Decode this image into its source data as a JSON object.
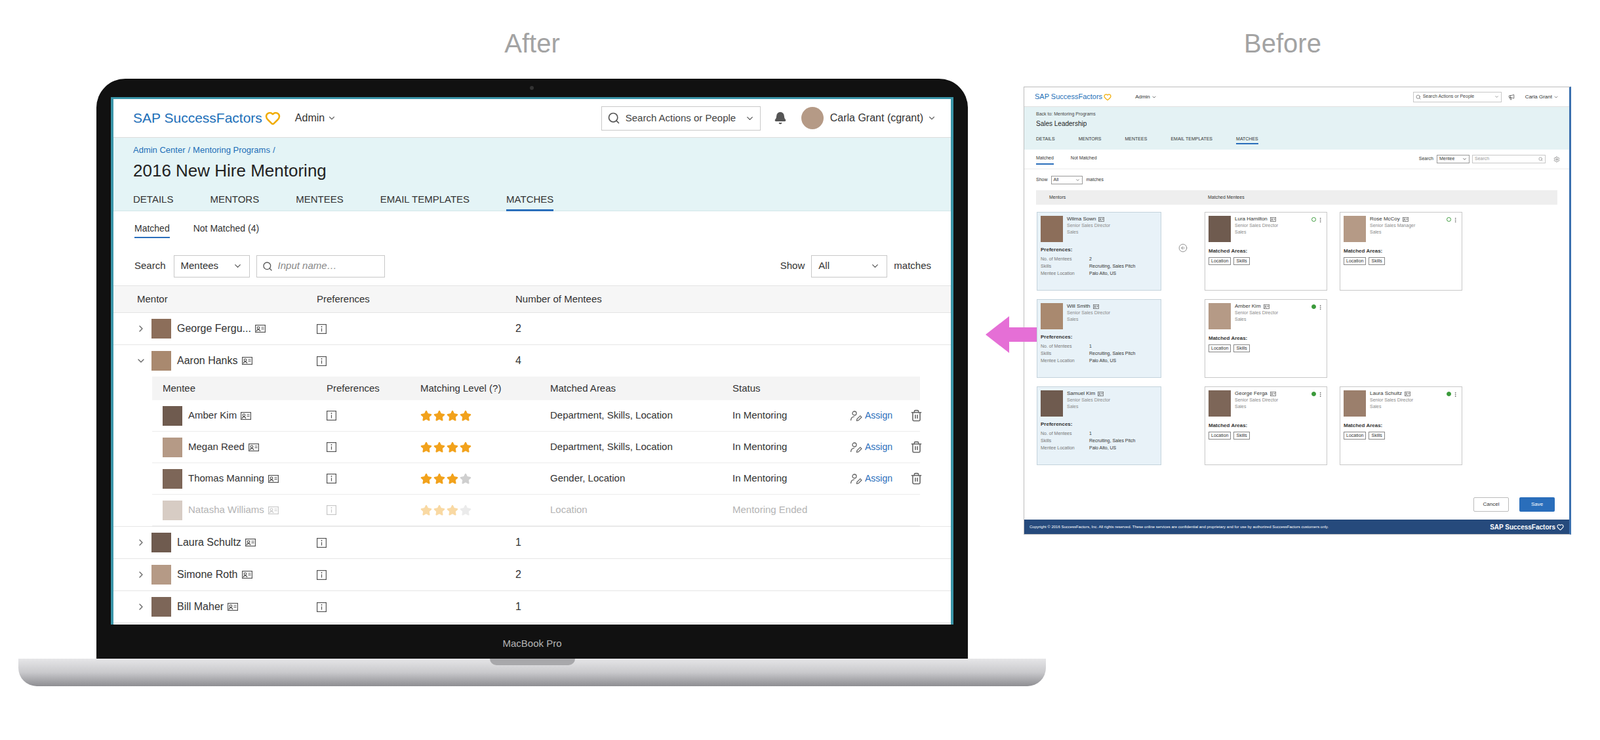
{
  "page_labels": {
    "after": "After",
    "before": "Before"
  },
  "laptop": {
    "model": "MacBook Pro"
  },
  "after": {
    "header": {
      "logo": "SAP SuccessFactors",
      "menu": "Admin",
      "search_placeholder": "Search Actions or People",
      "user": "Carla Grant (cgrant)"
    },
    "breadcrumb": {
      "items": [
        "Admin Center",
        "Mentoring Programs"
      ],
      "separator": "/"
    },
    "title": "2016 New Hire Mentoring",
    "tabs": [
      {
        "label": "DETAILS",
        "selected": false
      },
      {
        "label": "MENTORS",
        "selected": false
      },
      {
        "label": "MENTEES",
        "selected": false
      },
      {
        "label": "EMAIL TEMPLATES",
        "selected": false
      },
      {
        "label": "MATCHES",
        "selected": true
      }
    ],
    "subtabs": [
      {
        "label": "Matched",
        "selected": true
      },
      {
        "label": "Not Matched (4)",
        "selected": false
      }
    ],
    "search": {
      "label": "Search",
      "scope": "Mentees",
      "placeholder": "Input name…"
    },
    "show": {
      "label": "Show",
      "value": "All",
      "suffix": "matches"
    },
    "mentor_columns": [
      "Mentor",
      "Preferences",
      "Number of Mentees"
    ],
    "mentee_columns": [
      "Mentee",
      "Preferences",
      "Matching Level (?)",
      "Matched Areas",
      "Status"
    ],
    "mentors": [
      {
        "name": "George Fergu...",
        "mentees_count": "2",
        "expanded": false
      },
      {
        "name": "Aaron Hanks",
        "mentees_count": "4",
        "expanded": true,
        "mentees": [
          {
            "name": "Amber Kim",
            "stars": 4,
            "areas": "Department, Skills, Location",
            "status": "In Mentoring",
            "disabled": false,
            "action": "Assign"
          },
          {
            "name": "Megan Reed",
            "stars": 4,
            "areas": "Department, Skills, Location",
            "status": "In Mentoring",
            "disabled": false,
            "action": "Assign"
          },
          {
            "name": "Thomas Manning",
            "stars": 3,
            "areas": "Gender, Location",
            "status": "In Mentoring",
            "disabled": false,
            "action": "Assign"
          },
          {
            "name": "Natasha Williams",
            "stars": 3,
            "areas": "Location",
            "status": "Mentoring Ended",
            "disabled": true
          }
        ]
      },
      {
        "name": "Laura Schultz",
        "mentees_count": "1",
        "expanded": false
      },
      {
        "name": "Simone Roth",
        "mentees_count": "2",
        "expanded": false
      },
      {
        "name": "Bill Maher",
        "mentees_count": "1",
        "expanded": false
      }
    ]
  },
  "before": {
    "header": {
      "logo": "SAP SuccessFactors",
      "menu": "Admin",
      "search_placeholder": "Search Actions or People",
      "user": "Carla Grant"
    },
    "back_link": "Back to: Mentoring Programs",
    "title": "Sales Leadership",
    "tabs": [
      {
        "label": "DETAILS",
        "selected": false
      },
      {
        "label": "MENTORS",
        "selected": false
      },
      {
        "label": "MENTEES",
        "selected": false
      },
      {
        "label": "EMAIL TEMPLATES",
        "selected": false
      },
      {
        "label": "MATCHES",
        "selected": true
      }
    ],
    "subtabs": [
      {
        "label": "Matched",
        "selected": true
      },
      {
        "label": "Not Matched",
        "selected": false
      }
    ],
    "search": {
      "label": "Search",
      "scope": "Mentee",
      "placeholder": "Search"
    },
    "show": {
      "label": "Show",
      "value": "All",
      "suffix": "matches"
    },
    "columns": [
      "Mentors",
      "Matched Mentees"
    ],
    "preferences_label": "Preferences:",
    "matched_areas_label": "Matched Areas:",
    "pairs": [
      {
        "has_toggle": true,
        "mentor": {
          "name": "Wilma Sown",
          "title": "Senior Sales Director",
          "department": "Sales",
          "preferences": [
            {
              "key": "No. of Mentees",
              "value": "2"
            },
            {
              "key": "Skills",
              "value": "Recruiting, Sales Pitch"
            },
            {
              "key": "Mentee Location",
              "value": "Palo Alto, US"
            }
          ]
        },
        "mentees": [
          {
            "name": "Lura Hamilton",
            "title": "Senior Sales Director",
            "department": "Sales",
            "confirmed": false,
            "areas": [
              "Location",
              "Skills"
            ]
          },
          {
            "name": "Rose McCoy",
            "title": "Senior Sales Manager",
            "department": "Sales",
            "confirmed": false,
            "areas": [
              "Location",
              "Skills"
            ]
          }
        ]
      },
      {
        "has_toggle": false,
        "mentor": {
          "name": "Will Smith",
          "title": "Senior Sales Director",
          "department": "Sales",
          "preferences": [
            {
              "key": "No. of Mentees",
              "value": "1"
            },
            {
              "key": "Skills",
              "value": "Recruiting, Sales Pitch"
            },
            {
              "key": "Mentee Location",
              "value": "Palo Alto, US"
            }
          ]
        },
        "mentees": [
          {
            "name": "Amber Kim",
            "title": "Senior Sales Director",
            "department": "Sales",
            "confirmed": true,
            "areas": [
              "Location",
              "Skills"
            ]
          }
        ]
      },
      {
        "has_toggle": false,
        "mentor": {
          "name": "Samuel Kim",
          "title": "Senior Sales Director",
          "department": "Sales",
          "preferences": [
            {
              "key": "No. of Mentees",
              "value": "1"
            },
            {
              "key": "Skills",
              "value": "Recruiting, Sales Pitch"
            },
            {
              "key": "Mentee Location",
              "value": "Palo Alto, US"
            }
          ]
        },
        "mentees": [
          {
            "name": "George Ferga",
            "title": "Senior Sales Director",
            "department": "Sales",
            "confirmed": true,
            "areas": [
              "Location",
              "Skills"
            ]
          },
          {
            "name": "Laura Schultz",
            "title": "Senior Sales Director",
            "department": "Sales",
            "confirmed": true,
            "areas": [
              "Location",
              "Skills"
            ]
          }
        ]
      }
    ],
    "buttons": [
      {
        "label": "Cancel",
        "primary": false
      },
      {
        "label": "Save",
        "primary": true
      }
    ],
    "footer": {
      "copyright": "Copyright © 2016 SuccessFactors, Inc. All rights reserved. These online services are confidential and proprietary and for use by authorized SuccessFactors customers only.",
      "logo": "SAP SuccessFactors"
    }
  }
}
